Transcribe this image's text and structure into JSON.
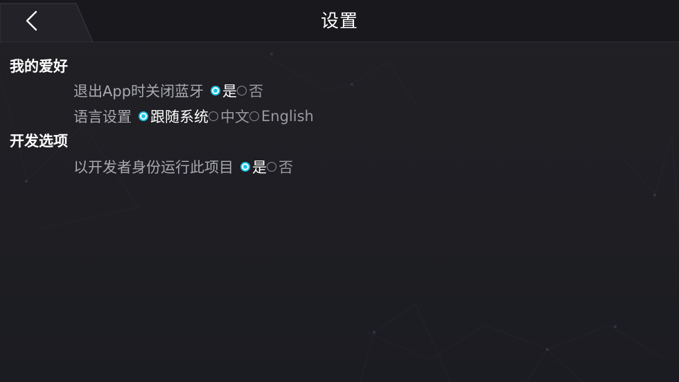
{
  "header": {
    "title": "设置",
    "back_icon": "chevron-left-icon"
  },
  "sections": [
    {
      "title": "我的爱好",
      "rows": [
        {
          "label": "退出App时关闭蓝牙",
          "options": [
            {
              "label": "是",
              "checked": true
            },
            {
              "label": "否",
              "checked": false
            }
          ]
        },
        {
          "label": "语言设置",
          "options": [
            {
              "label": "跟随系统",
              "checked": true
            },
            {
              "label": "中文",
              "checked": false
            },
            {
              "label": "English",
              "checked": false
            }
          ]
        }
      ]
    },
    {
      "title": "开发选项",
      "rows": [
        {
          "label": "以开发者身份运行此项目",
          "options": [
            {
              "label": "是",
              "checked": true
            },
            {
              "label": "否",
              "checked": false
            }
          ]
        }
      ]
    }
  ],
  "colors": {
    "accent": "#18c4ea",
    "background": "#1f1f24",
    "header": "#19191d",
    "label": "#a9a9b1"
  }
}
